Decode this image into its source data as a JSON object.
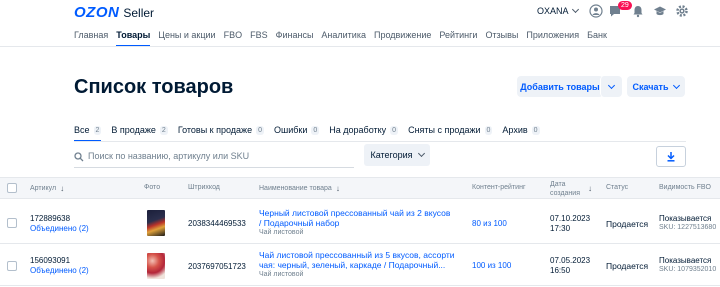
{
  "header": {
    "logo_brand": "OZON",
    "logo_product": "Seller",
    "account_name": "OXANA",
    "notifications_badge": "29"
  },
  "nav": {
    "items": [
      {
        "label": "Главная",
        "active": false
      },
      {
        "label": "Товары",
        "active": true
      },
      {
        "label": "Цены и акции",
        "active": false
      },
      {
        "label": "FBO",
        "active": false
      },
      {
        "label": "FBS",
        "active": false
      },
      {
        "label": "Финансы",
        "active": false
      },
      {
        "label": "Аналитика",
        "active": false
      },
      {
        "label": "Продвижение",
        "active": false
      },
      {
        "label": "Рейтинги",
        "active": false
      },
      {
        "label": "Отзывы",
        "active": false
      },
      {
        "label": "Приложения",
        "active": false
      },
      {
        "label": "Банк",
        "active": false
      }
    ]
  },
  "page": {
    "title": "Список товаров",
    "add_button_label": "Добавить товары",
    "download_button_label": "Скачать"
  },
  "filters": [
    {
      "label": "Все",
      "count": "2",
      "active": true
    },
    {
      "label": "В продаже",
      "count": "2",
      "active": false
    },
    {
      "label": "Готовы к продаже",
      "count": "0",
      "active": false
    },
    {
      "label": "Ошибки",
      "count": "0",
      "active": false
    },
    {
      "label": "На доработку",
      "count": "0",
      "active": false
    },
    {
      "label": "Сняты с продажи",
      "count": "0",
      "active": false
    },
    {
      "label": "Архив",
      "count": "0",
      "active": false
    }
  ],
  "search": {
    "placeholder": "Поиск по названию, артикулу или SKU",
    "category_label": "Категория"
  },
  "table": {
    "columns": {
      "article": "Артикул",
      "photo": "Фото",
      "barcode": "Штрихкод",
      "name": "Наименование товара",
      "rating": "Контент-рейтинг",
      "date_line1": "Дата",
      "date_line2": "создания",
      "status": "Статус",
      "visibility": "Видимость FBO"
    },
    "rows": [
      {
        "article": "172889638",
        "merged": "Объединено (2)",
        "barcode": "2038344469533",
        "name": "Черный листовой прессованный чай из 2 вкусов / Подарочный набор",
        "category": "Чай листовой",
        "rating": "80 из 100",
        "date": "07.10.2023",
        "time": "17:30",
        "status": "Продается",
        "visibility": "Показывается",
        "sku": "SKU: 1227513680"
      },
      {
        "article": "156093091",
        "merged": "Объединено (2)",
        "barcode": "2037697051723",
        "name": "Чай листовой прессованный из 5 вкусов, ассорти чая: черный, зеленый, каркаде / Подарочный...",
        "category": "Чай листовой",
        "rating": "100 из 100",
        "date": "07.05.2023",
        "time": "16:50",
        "status": "Продается",
        "visibility": "Показывается",
        "sku": "SKU: 1079352010"
      }
    ]
  },
  "colors": {
    "accent": "#005bff",
    "text": "#001a34",
    "muted": "#70808f",
    "badge": "#f91155"
  }
}
